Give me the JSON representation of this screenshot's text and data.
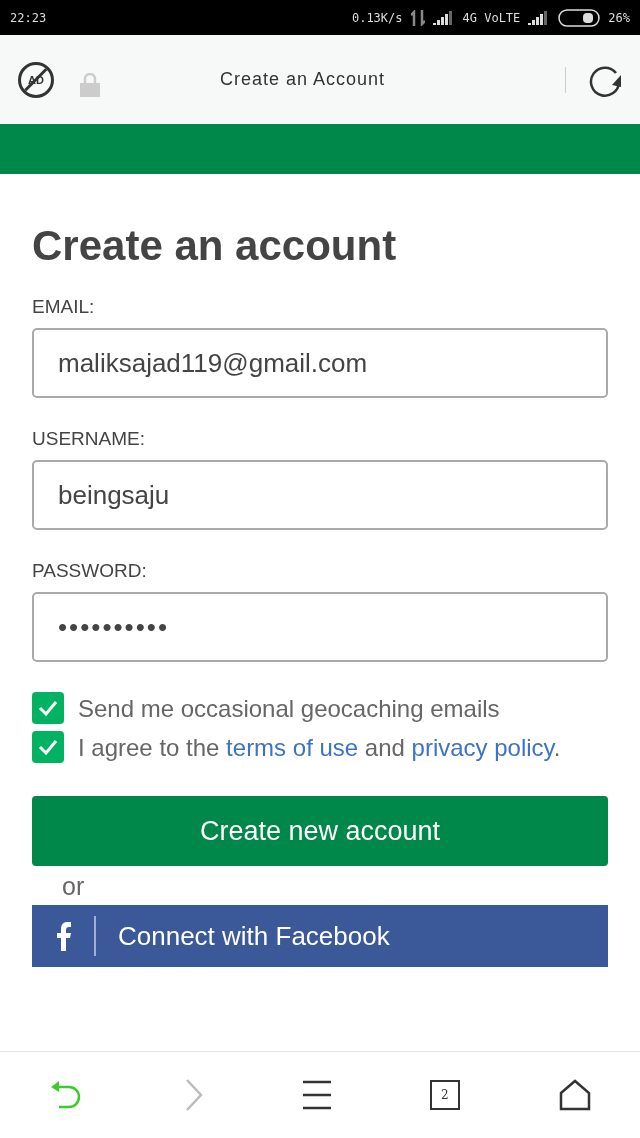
{
  "status_bar": {
    "time": "22:23",
    "speed": "0.13K/s",
    "network": "4G VoLTE",
    "battery": "26%"
  },
  "top_bar": {
    "ad_badge": "AD",
    "title": "Create an Account"
  },
  "form": {
    "heading": "Create an account",
    "fields": [
      {
        "label": "EMAIL:",
        "value": "maliksajad119@gmail.com",
        "kind": "text"
      },
      {
        "label": "USERNAME:",
        "value": "beingsaju",
        "kind": "text"
      },
      {
        "label": "PASSWORD:",
        "value": "••••••••••",
        "kind": "password"
      }
    ],
    "checkboxes": [
      {
        "checked": true,
        "parts": [
          {
            "kind": "text",
            "text": "Send me occasional geocaching emails"
          }
        ]
      },
      {
        "checked": true,
        "parts": [
          {
            "kind": "text",
            "text": "I agree to the "
          },
          {
            "kind": "link",
            "text": "terms of use"
          },
          {
            "kind": "text",
            "text": " and "
          },
          {
            "kind": "link",
            "text": "privacy policy"
          },
          {
            "kind": "text",
            "text": "."
          }
        ]
      }
    ],
    "submit": "Create new account",
    "or": "or",
    "facebook": "Connect with Facebook"
  },
  "bottom_nav": [
    {
      "kind": "back",
      "disabled": false
    },
    {
      "kind": "forward",
      "disabled": true
    },
    {
      "kind": "menu",
      "disabled": false
    },
    {
      "kind": "tabs",
      "count": "2",
      "disabled": false
    },
    {
      "kind": "home",
      "disabled": false
    }
  ]
}
